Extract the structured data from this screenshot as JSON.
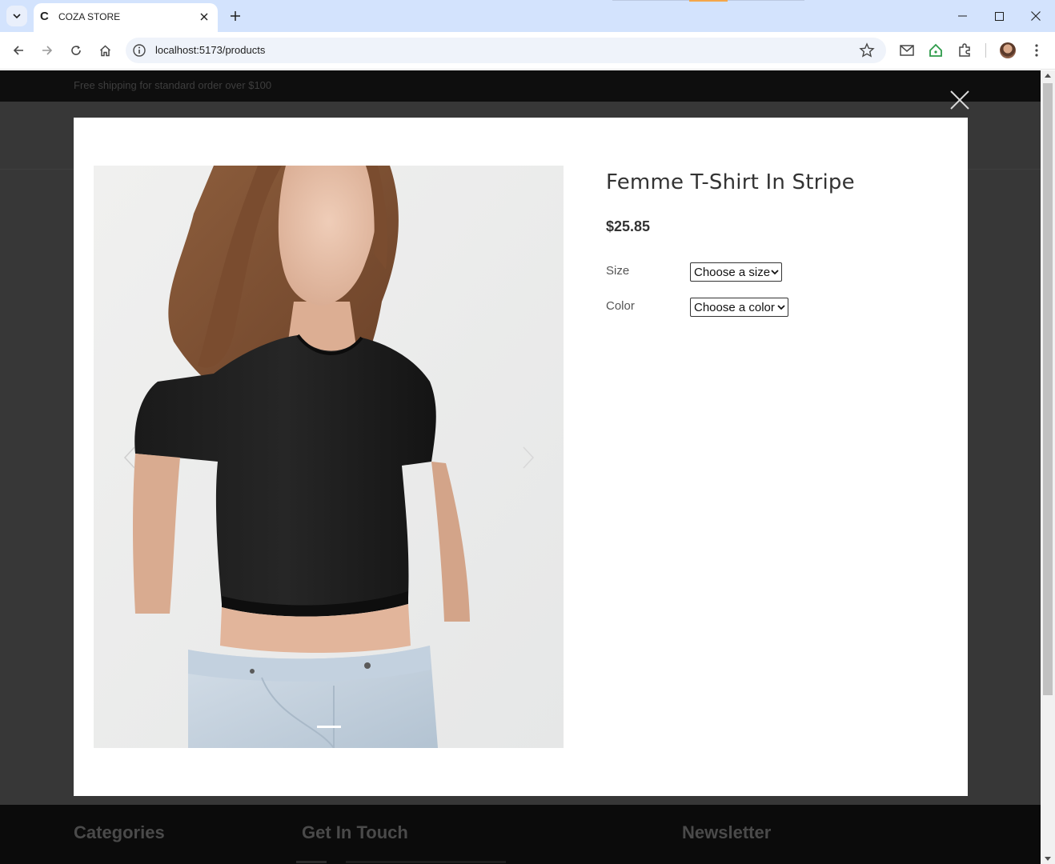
{
  "browser": {
    "tab_title": "COZA STORE",
    "tab_favicon": "C",
    "url": "localhost:5173/products",
    "icons": [
      "tab-list-icon",
      "close-icon",
      "plus-icon",
      "minimize-icon",
      "maximize-icon",
      "window-close-icon",
      "back-icon",
      "forward-icon",
      "reload-icon",
      "home-icon",
      "site-info-icon",
      "star-icon",
      "mail-extension-icon",
      "home-extension-icon",
      "puzzle-icon",
      "profile-avatar",
      "kebab-menu-icon"
    ]
  },
  "page": {
    "topbar_text": "Free shipping for standard order over $100",
    "footer": {
      "col1": "Categories",
      "col2": "Get In Touch",
      "col3": "Newsletter"
    }
  },
  "modal": {
    "product_name": "Femme T-Shirt In Stripe",
    "price": "$25.85",
    "size_label": "Size",
    "size_value": "Choose a size",
    "color_label": "Color",
    "color_value": "Choose a color",
    "gallery_active_slide": 1,
    "colors": {
      "overlay": "#373737",
      "shirt": "#1e1e1e",
      "jeans": "#c8d6e4",
      "photo_bg": "#ececec"
    }
  }
}
